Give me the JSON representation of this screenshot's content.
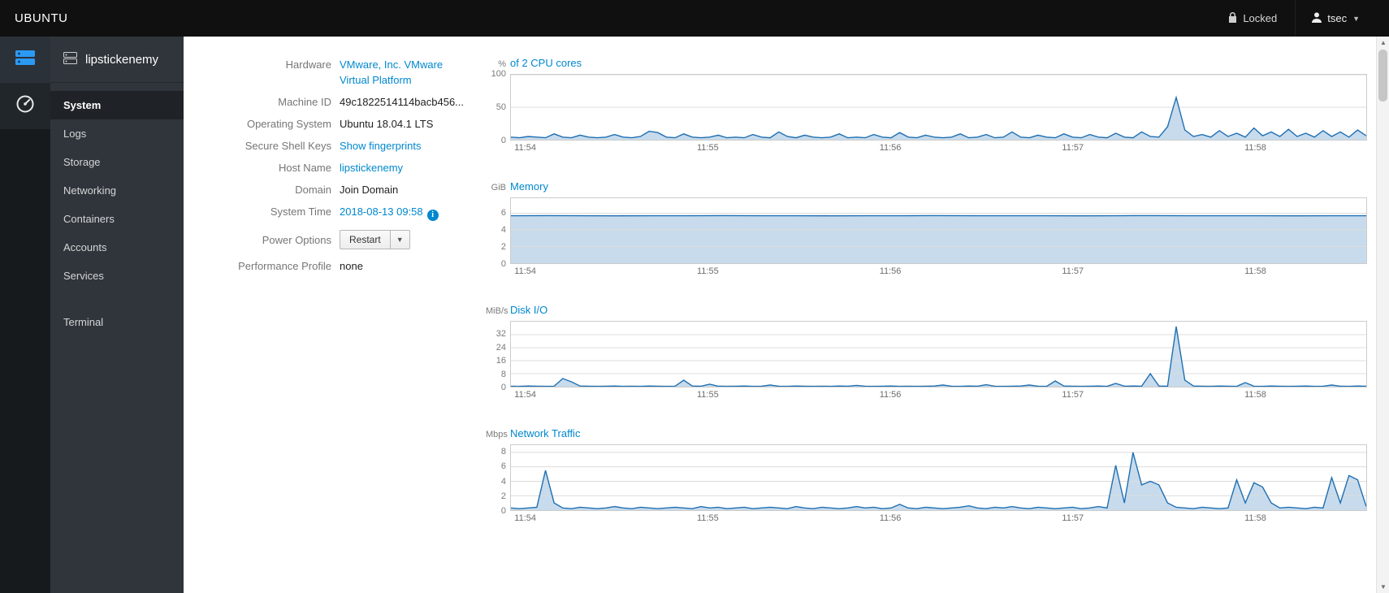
{
  "colors": {
    "accent": "#0088ce",
    "chart_stroke": "#1f6fb2",
    "chart_fill": "rgba(54,126,186,0.28)",
    "grid": "#dcdcdc"
  },
  "topbar": {
    "brand": "UBUNTU",
    "locked_label": "Locked",
    "user_label": "tsec"
  },
  "sidebar": {
    "hostname": "lipstickenemy",
    "items": [
      {
        "label": "System",
        "selected": true
      },
      {
        "label": "Logs",
        "selected": false
      },
      {
        "label": "Storage",
        "selected": false
      },
      {
        "label": "Networking",
        "selected": false
      },
      {
        "label": "Containers",
        "selected": false
      },
      {
        "label": "Accounts",
        "selected": false
      },
      {
        "label": "Services",
        "selected": false
      }
    ],
    "secondary_items": [
      {
        "label": "Terminal"
      }
    ]
  },
  "details": {
    "hardware": {
      "label": "Hardware",
      "value_line1": "VMware, Inc. VMware",
      "value_line2": "Virtual Platform"
    },
    "machine_id": {
      "label": "Machine ID",
      "value": "49c1822514114bacb456..."
    },
    "os": {
      "label": "Operating System",
      "value": "Ubuntu 18.04.1 LTS"
    },
    "ssh": {
      "label": "Secure Shell Keys",
      "value": "Show fingerprints"
    },
    "hostname": {
      "label": "Host Name",
      "value": "lipstickenemy"
    },
    "domain": {
      "label": "Domain",
      "value": "Join Domain"
    },
    "time": {
      "label": "System Time",
      "value": "2018-08-13 09:58"
    },
    "power": {
      "label": "Power Options",
      "button_label": "Restart"
    },
    "profile": {
      "label": "Performance Profile",
      "value": "none"
    }
  },
  "chart_data": [
    {
      "type": "area",
      "unit": "%",
      "title": "of 2 CPU cores",
      "ylim": [
        0,
        100
      ],
      "yticks": [
        0,
        50,
        100
      ],
      "x_labels": [
        "11:54",
        "11:55",
        "11:56",
        "11:57",
        "11:58"
      ],
      "x_label_fractions": [
        0.005,
        0.218,
        0.431,
        0.644,
        0.857
      ],
      "values": [
        4,
        3,
        5,
        4,
        3,
        9,
        4,
        3,
        7,
        4,
        3,
        4,
        8,
        4,
        3,
        5,
        13,
        11,
        4,
        3,
        9,
        4,
        3,
        4,
        7,
        3,
        4,
        3,
        8,
        4,
        3,
        12,
        5,
        3,
        7,
        4,
        3,
        4,
        9,
        3,
        4,
        3,
        8,
        4,
        3,
        11,
        4,
        3,
        7,
        4,
        3,
        4,
        9,
        3,
        4,
        8,
        3,
        4,
        12,
        4,
        3,
        7,
        4,
        3,
        9,
        4,
        3,
        8,
        4,
        3,
        10,
        4,
        3,
        12,
        5,
        4,
        20,
        65,
        15,
        5,
        8,
        4,
        14,
        5,
        10,
        4,
        18,
        6,
        12,
        5,
        16,
        5,
        10,
        4,
        14,
        5,
        12,
        4,
        15,
        6
      ]
    },
    {
      "type": "area",
      "unit": "GiB",
      "title": "Memory",
      "ylim": [
        0,
        7.8
      ],
      "yticks": [
        0,
        2,
        4,
        6
      ],
      "x_labels": [
        "11:54",
        "11:55",
        "11:56",
        "11:57",
        "11:58"
      ],
      "x_label_fractions": [
        0.005,
        0.218,
        0.431,
        0.644,
        0.857
      ],
      "values": [
        5.7,
        5.71,
        5.7,
        5.69,
        5.7,
        5.7,
        5.71,
        5.7,
        5.7,
        5.69,
        5.7,
        5.7,
        5.71,
        5.7,
        5.7,
        5.7,
        5.69,
        5.7,
        5.71,
        5.7,
        5.7,
        5.7,
        5.69,
        5.7,
        5.7
      ]
    },
    {
      "type": "area",
      "unit": "MiB/s",
      "title": "Disk I/O",
      "ylim": [
        0,
        40
      ],
      "yticks": [
        0,
        8,
        16,
        24,
        32
      ],
      "x_labels": [
        "11:54",
        "11:55",
        "11:56",
        "11:57",
        "11:58"
      ],
      "x_label_fractions": [
        0.005,
        0.218,
        0.431,
        0.644,
        0.857
      ],
      "values": [
        0.3,
        0.2,
        0.4,
        0.3,
        0.2,
        0.3,
        5,
        3,
        0.4,
        0.3,
        0.2,
        0.3,
        0.4,
        0.2,
        0.3,
        0.2,
        0.4,
        0.3,
        0.2,
        0.3,
        4,
        0.4,
        0.3,
        1.5,
        0.3,
        0.2,
        0.3,
        0.4,
        0.2,
        0.3,
        1,
        0.3,
        0.2,
        0.4,
        0.3,
        0.2,
        0.3,
        0.2,
        0.4,
        0.3,
        0.8,
        0.3,
        0.2,
        0.3,
        0.4,
        0.2,
        0.3,
        0.2,
        0.3,
        0.4,
        1,
        0.3,
        0.2,
        0.4,
        0.3,
        1.2,
        0.3,
        0.2,
        0.3,
        0.4,
        1,
        0.3,
        0.2,
        3.5,
        0.4,
        0.3,
        0.2,
        0.3,
        0.4,
        0.2,
        2,
        0.3,
        0.4,
        0.3,
        8,
        0.4,
        0.3,
        37,
        4,
        0.4,
        0.3,
        0.2,
        0.4,
        0.3,
        0.2,
        2.5,
        0.3,
        0.2,
        0.4,
        0.3,
        0.2,
        0.3,
        0.4,
        0.2,
        0.3,
        1,
        0.3,
        0.2,
        0.4,
        0.3
      ]
    },
    {
      "type": "area",
      "unit": "Mbps",
      "title": "Network Traffic",
      "ylim": [
        0,
        9
      ],
      "yticks": [
        0,
        2,
        4,
        6,
        8
      ],
      "x_labels": [
        "11:54",
        "11:55",
        "11:56",
        "11:57",
        "11:58"
      ],
      "x_label_fractions": [
        0.005,
        0.218,
        0.431,
        0.644,
        0.857
      ],
      "values": [
        0.3,
        0.2,
        0.3,
        0.4,
        5.5,
        1,
        0.3,
        0.2,
        0.4,
        0.3,
        0.2,
        0.3,
        0.5,
        0.3,
        0.2,
        0.4,
        0.3,
        0.2,
        0.3,
        0.4,
        0.3,
        0.2,
        0.5,
        0.3,
        0.4,
        0.2,
        0.3,
        0.4,
        0.2,
        0.3,
        0.4,
        0.3,
        0.2,
        0.5,
        0.3,
        0.2,
        0.4,
        0.3,
        0.2,
        0.3,
        0.5,
        0.3,
        0.4,
        0.2,
        0.3,
        0.8,
        0.3,
        0.2,
        0.4,
        0.3,
        0.2,
        0.3,
        0.4,
        0.6,
        0.3,
        0.2,
        0.4,
        0.3,
        0.5,
        0.3,
        0.2,
        0.4,
        0.3,
        0.2,
        0.3,
        0.4,
        0.2,
        0.3,
        0.5,
        0.3,
        6.2,
        1,
        8,
        3.5,
        4,
        3.5,
        1,
        0.4,
        0.3,
        0.2,
        0.4,
        0.3,
        0.2,
        0.3,
        4.2,
        1,
        3.8,
        3.2,
        1,
        0.3,
        0.4,
        0.3,
        0.2,
        0.4,
        0.3,
        4.5,
        1,
        4.8,
        4.2,
        0.5
      ]
    }
  ]
}
